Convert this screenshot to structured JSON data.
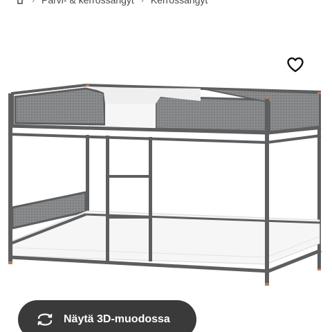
{
  "breadcrumb": {
    "items": [
      "Parvi- & kerrossängyt",
      "Kerrossängyt"
    ]
  },
  "product": {
    "favourite_icon": "heart-outline-icon"
  },
  "view3d": {
    "label": "Näytä 3D-muodossa",
    "icon": "rotate-3d-icon"
  },
  "colors": {
    "frame": "#5d5e60",
    "mesh": "#7b7c7e",
    "mattress": "#f6f6f6",
    "button_bg": "#3a3a3a",
    "button_text": "#ffffff",
    "foot_cap": "#b87a5c"
  }
}
